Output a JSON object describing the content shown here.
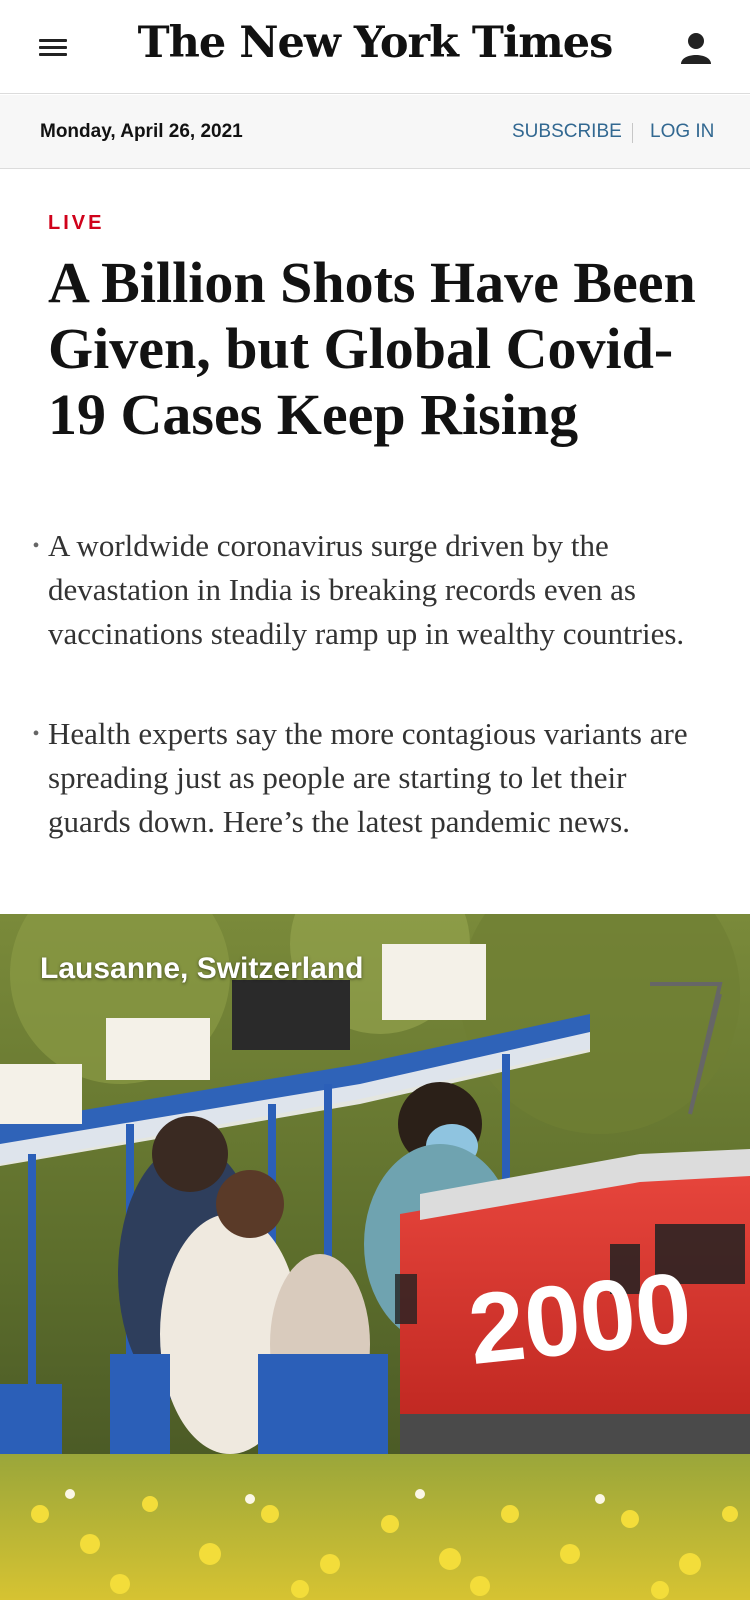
{
  "header": {
    "masthead": "The New York Times",
    "menu_icon": "hamburger-icon",
    "account_icon": "user-icon"
  },
  "datebar": {
    "date": "Monday, April 26, 2021",
    "subscribe": "SUBSCRIBE",
    "login": "LOG IN"
  },
  "article": {
    "label": "LIVE",
    "headline": "A Billion Shots Have Been Given, but Global Covid-19 Cases Keep Rising",
    "summary": [
      "A worldwide coronavirus surge driven by the devastation in India is breaking records even as vaccinations steadily ramp up in wealthy countries.",
      "Health experts say the more contagious variants are spreading just as people are starting to let their guards down. Here’s the latest pandemic news."
    ],
    "photo_location": "Lausanne, Switzerland",
    "photo_locomotive_number": "2000"
  },
  "colors": {
    "live_red": "#d0021b",
    "link_blue": "#326891",
    "datebar_bg": "#f7f7f7"
  }
}
